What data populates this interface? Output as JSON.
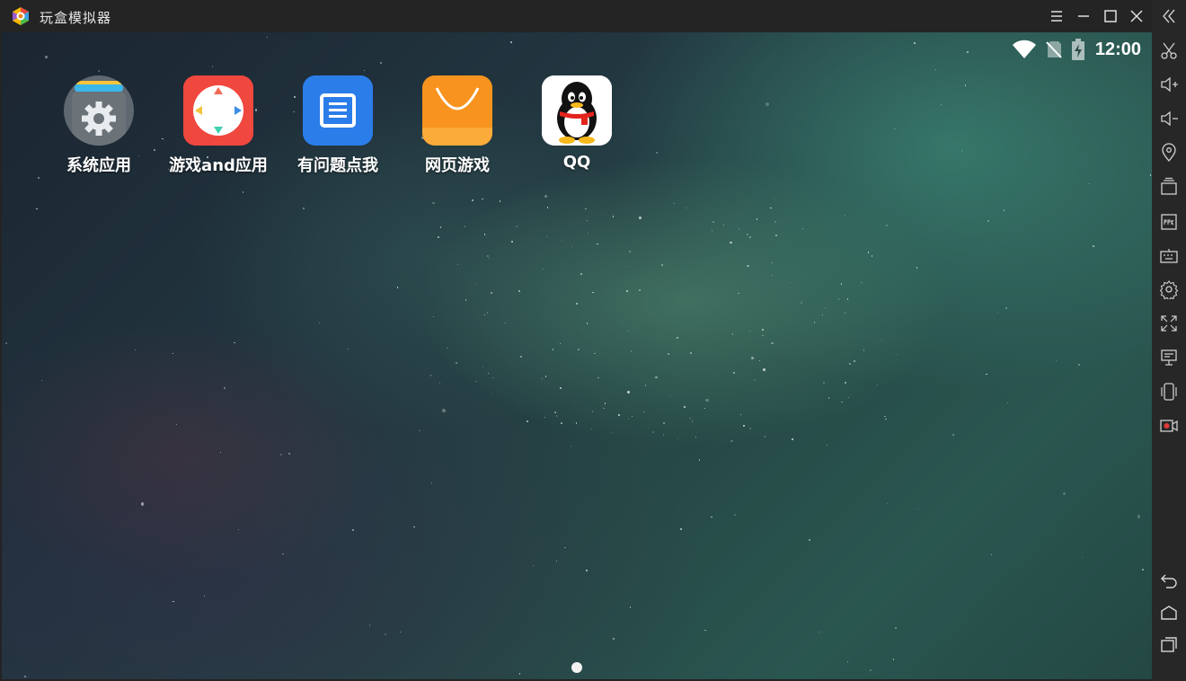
{
  "window": {
    "title": "玩盒模拟器"
  },
  "status_bar": {
    "time": "12:00"
  },
  "apps": [
    {
      "label": "系统应用",
      "icon": "settings-folder-icon"
    },
    {
      "label": "游戏and应用",
      "icon": "game-compass-icon"
    },
    {
      "label": "有问题点我",
      "icon": "document-list-icon"
    },
    {
      "label": "网页游戏",
      "icon": "shopping-bag-icon"
    },
    {
      "label": "QQ",
      "icon": "qq-penguin-icon"
    }
  ],
  "toolbar": [
    "collapse-icon",
    "cut-icon",
    "volume-up-icon",
    "volume-down-icon",
    "location-icon",
    "multi-window-icon",
    "apk-icon",
    "keyboard-icon",
    "settings-icon",
    "fullscreen-icon",
    "screen-icon",
    "shake-icon",
    "record-icon",
    "back-icon",
    "home-icon",
    "recents-icon"
  ],
  "colors": {
    "titlebar": "#242424",
    "sidebar": "#272727",
    "settings_icon_bg": "#5f6770",
    "game_icon_bg": "#f0473f",
    "doc_icon_bg": "#2b7de9",
    "bag_icon_bg": "#f7931e",
    "record_accent": "#e03a3a"
  }
}
